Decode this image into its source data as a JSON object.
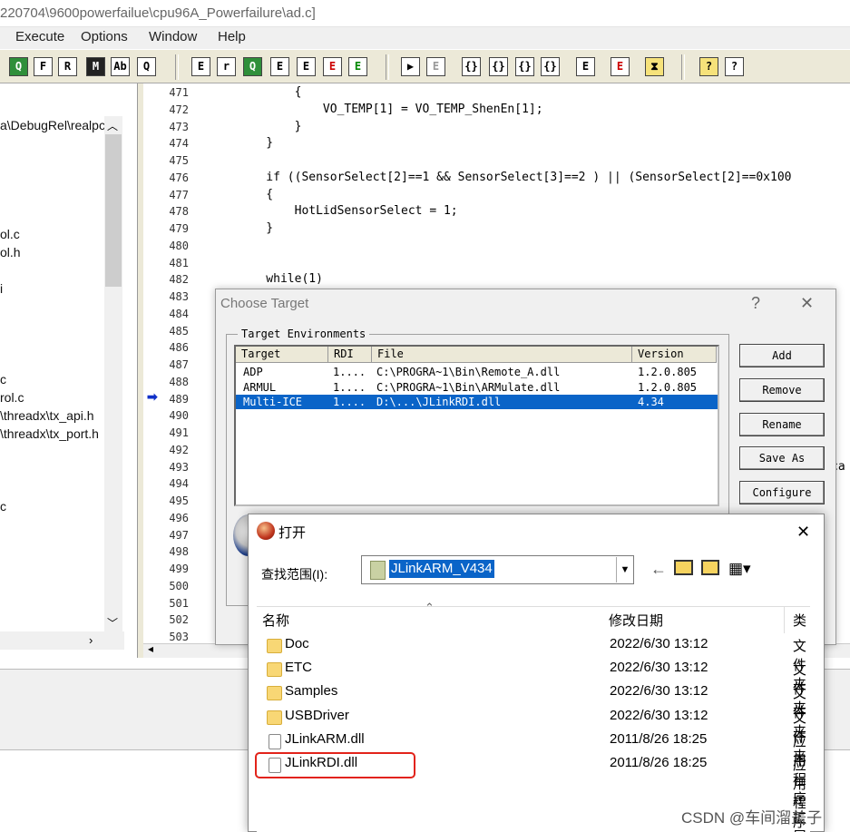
{
  "window": {
    "title": "220704\\9600powerfailue\\cpu96A_Powerfailure\\ad.c]"
  },
  "menu": [
    "Execute",
    "Options",
    "Window",
    "Help"
  ],
  "toolbar": {
    "buttons": [
      "Q",
      "F",
      "R",
      "M",
      "Ab",
      "Q",
      "E",
      "r",
      "Q",
      "E",
      "E",
      "E",
      "E",
      "▶",
      "E",
      "{}",
      "{}",
      "{}",
      "{}",
      "E",
      "E",
      "⧗",
      "?",
      "?"
    ]
  },
  "left_panel": {
    "items": [
      {
        "text": "a\\DebugRel\\realpci"
      },
      {
        "text": "ol.c"
      },
      {
        "text": "ol.h"
      },
      {
        "text": "i"
      },
      {
        "text": "c"
      },
      {
        "text": "rol.c"
      },
      {
        "text": "\\threadx\\tx_api.h"
      },
      {
        "text": "\\threadx\\tx_port.h"
      },
      {
        "text": "c"
      }
    ]
  },
  "editor": {
    "line_numbers": [
      "471",
      "472",
      "473",
      "474",
      "475",
      "476",
      "477",
      "478",
      "479",
      "480",
      "481",
      "482",
      "483",
      "484",
      "485",
      "486",
      "487",
      "488",
      "489",
      "490",
      "491",
      "492",
      "493",
      "494",
      "495",
      "496",
      "497",
      "498",
      "499",
      "500",
      "501",
      "502",
      "503"
    ],
    "current_line": "489",
    "code": [
      {
        "line": "471",
        "text": "        {"
      },
      {
        "line": "472",
        "text": "            VO_TEMP[1] = VO_TEMP_ShenEn[1];"
      },
      {
        "line": "473",
        "text": "        }"
      },
      {
        "line": "474",
        "text": "    }"
      },
      {
        "line": "476",
        "text": "    if ((SensorSelect[2]==1 && SensorSelect[3]==2 ) || (SensorSelect[2]==0x100"
      },
      {
        "line": "477",
        "text": "    {"
      },
      {
        "line": "478",
        "text": "        HotLidSensorSelect = 1;"
      },
      {
        "line": "479",
        "text": "    }"
      },
      {
        "line": "482",
        "text": "    while(1)"
      }
    ],
    "peek_text": "ca"
  },
  "choose_target": {
    "title": "Choose Target",
    "help_btn": "?",
    "close_btn": "✕",
    "group_label": "Target Environments",
    "columns": [
      "Target",
      "RDI",
      "File",
      "Version"
    ],
    "rows": [
      {
        "target": "ADP",
        "rdi": "1....",
        "file": "C:\\PROGRA~1\\Bin\\Remote_A.dll",
        "version": "1.2.0.805",
        "selected": false
      },
      {
        "target": "ARMUL",
        "rdi": "1....",
        "file": "C:\\PROGRA~1\\Bin\\ARMulate.dll",
        "version": "1.2.0.805",
        "selected": false
      },
      {
        "target": "Multi-ICE",
        "rdi": "1....",
        "file": "D:\\...\\JLinkRDI.dll",
        "version": "4.34",
        "selected": true
      }
    ],
    "buttons": {
      "add": "Add",
      "remove": "Remove",
      "rename": "Rename",
      "save_as": "Save As",
      "configure": "Configure"
    }
  },
  "open_dialog": {
    "title": "打开",
    "close_btn": "✕",
    "look_in_label": "查找范围(I):",
    "look_in_value": "JLinkARM_V434",
    "columns": {
      "name": "名称",
      "date": "修改日期",
      "type": "类"
    },
    "files": [
      {
        "name": "Doc",
        "date": "2022/6/30 13:12",
        "type": "文件夹",
        "kind": "folder"
      },
      {
        "name": "ETC",
        "date": "2022/6/30 13:12",
        "type": "文件夹",
        "kind": "folder"
      },
      {
        "name": "Samples",
        "date": "2022/6/30 13:12",
        "type": "文件夹",
        "kind": "folder"
      },
      {
        "name": "USBDriver",
        "date": "2022/6/30 13:12",
        "type": "文件夹",
        "kind": "folder"
      },
      {
        "name": "JLinkARM.dll",
        "date": "2011/8/26 18:25",
        "type": "应用程序扩展",
        "kind": "file"
      },
      {
        "name": "JLinkRDI.dll",
        "date": "2011/8/26 18:25",
        "type": "应用程序扩展",
        "kind": "file"
      }
    ]
  },
  "watermark": "CSDN @车间溜盖子",
  "colors": {
    "selection": "#0a64c8",
    "highlight_box": "#e2231a",
    "toolbar_bg": "#ece9d8"
  }
}
